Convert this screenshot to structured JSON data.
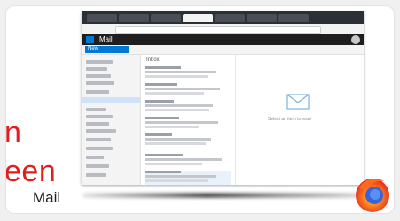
{
  "overlay_text": {
    "line1": "n",
    "line2": "een"
  },
  "caption": "Mail",
  "screenshot": {
    "app_name": "Mail",
    "new_button": "New",
    "list_header": "Inbox",
    "reading_pane_message": "Select an item to read"
  },
  "icons": {
    "envelope": "envelope-icon",
    "browser_logo": "firefox-logo-icon"
  },
  "colors": {
    "accent": "#0078d4",
    "overlay_red": "#e11d1d"
  }
}
